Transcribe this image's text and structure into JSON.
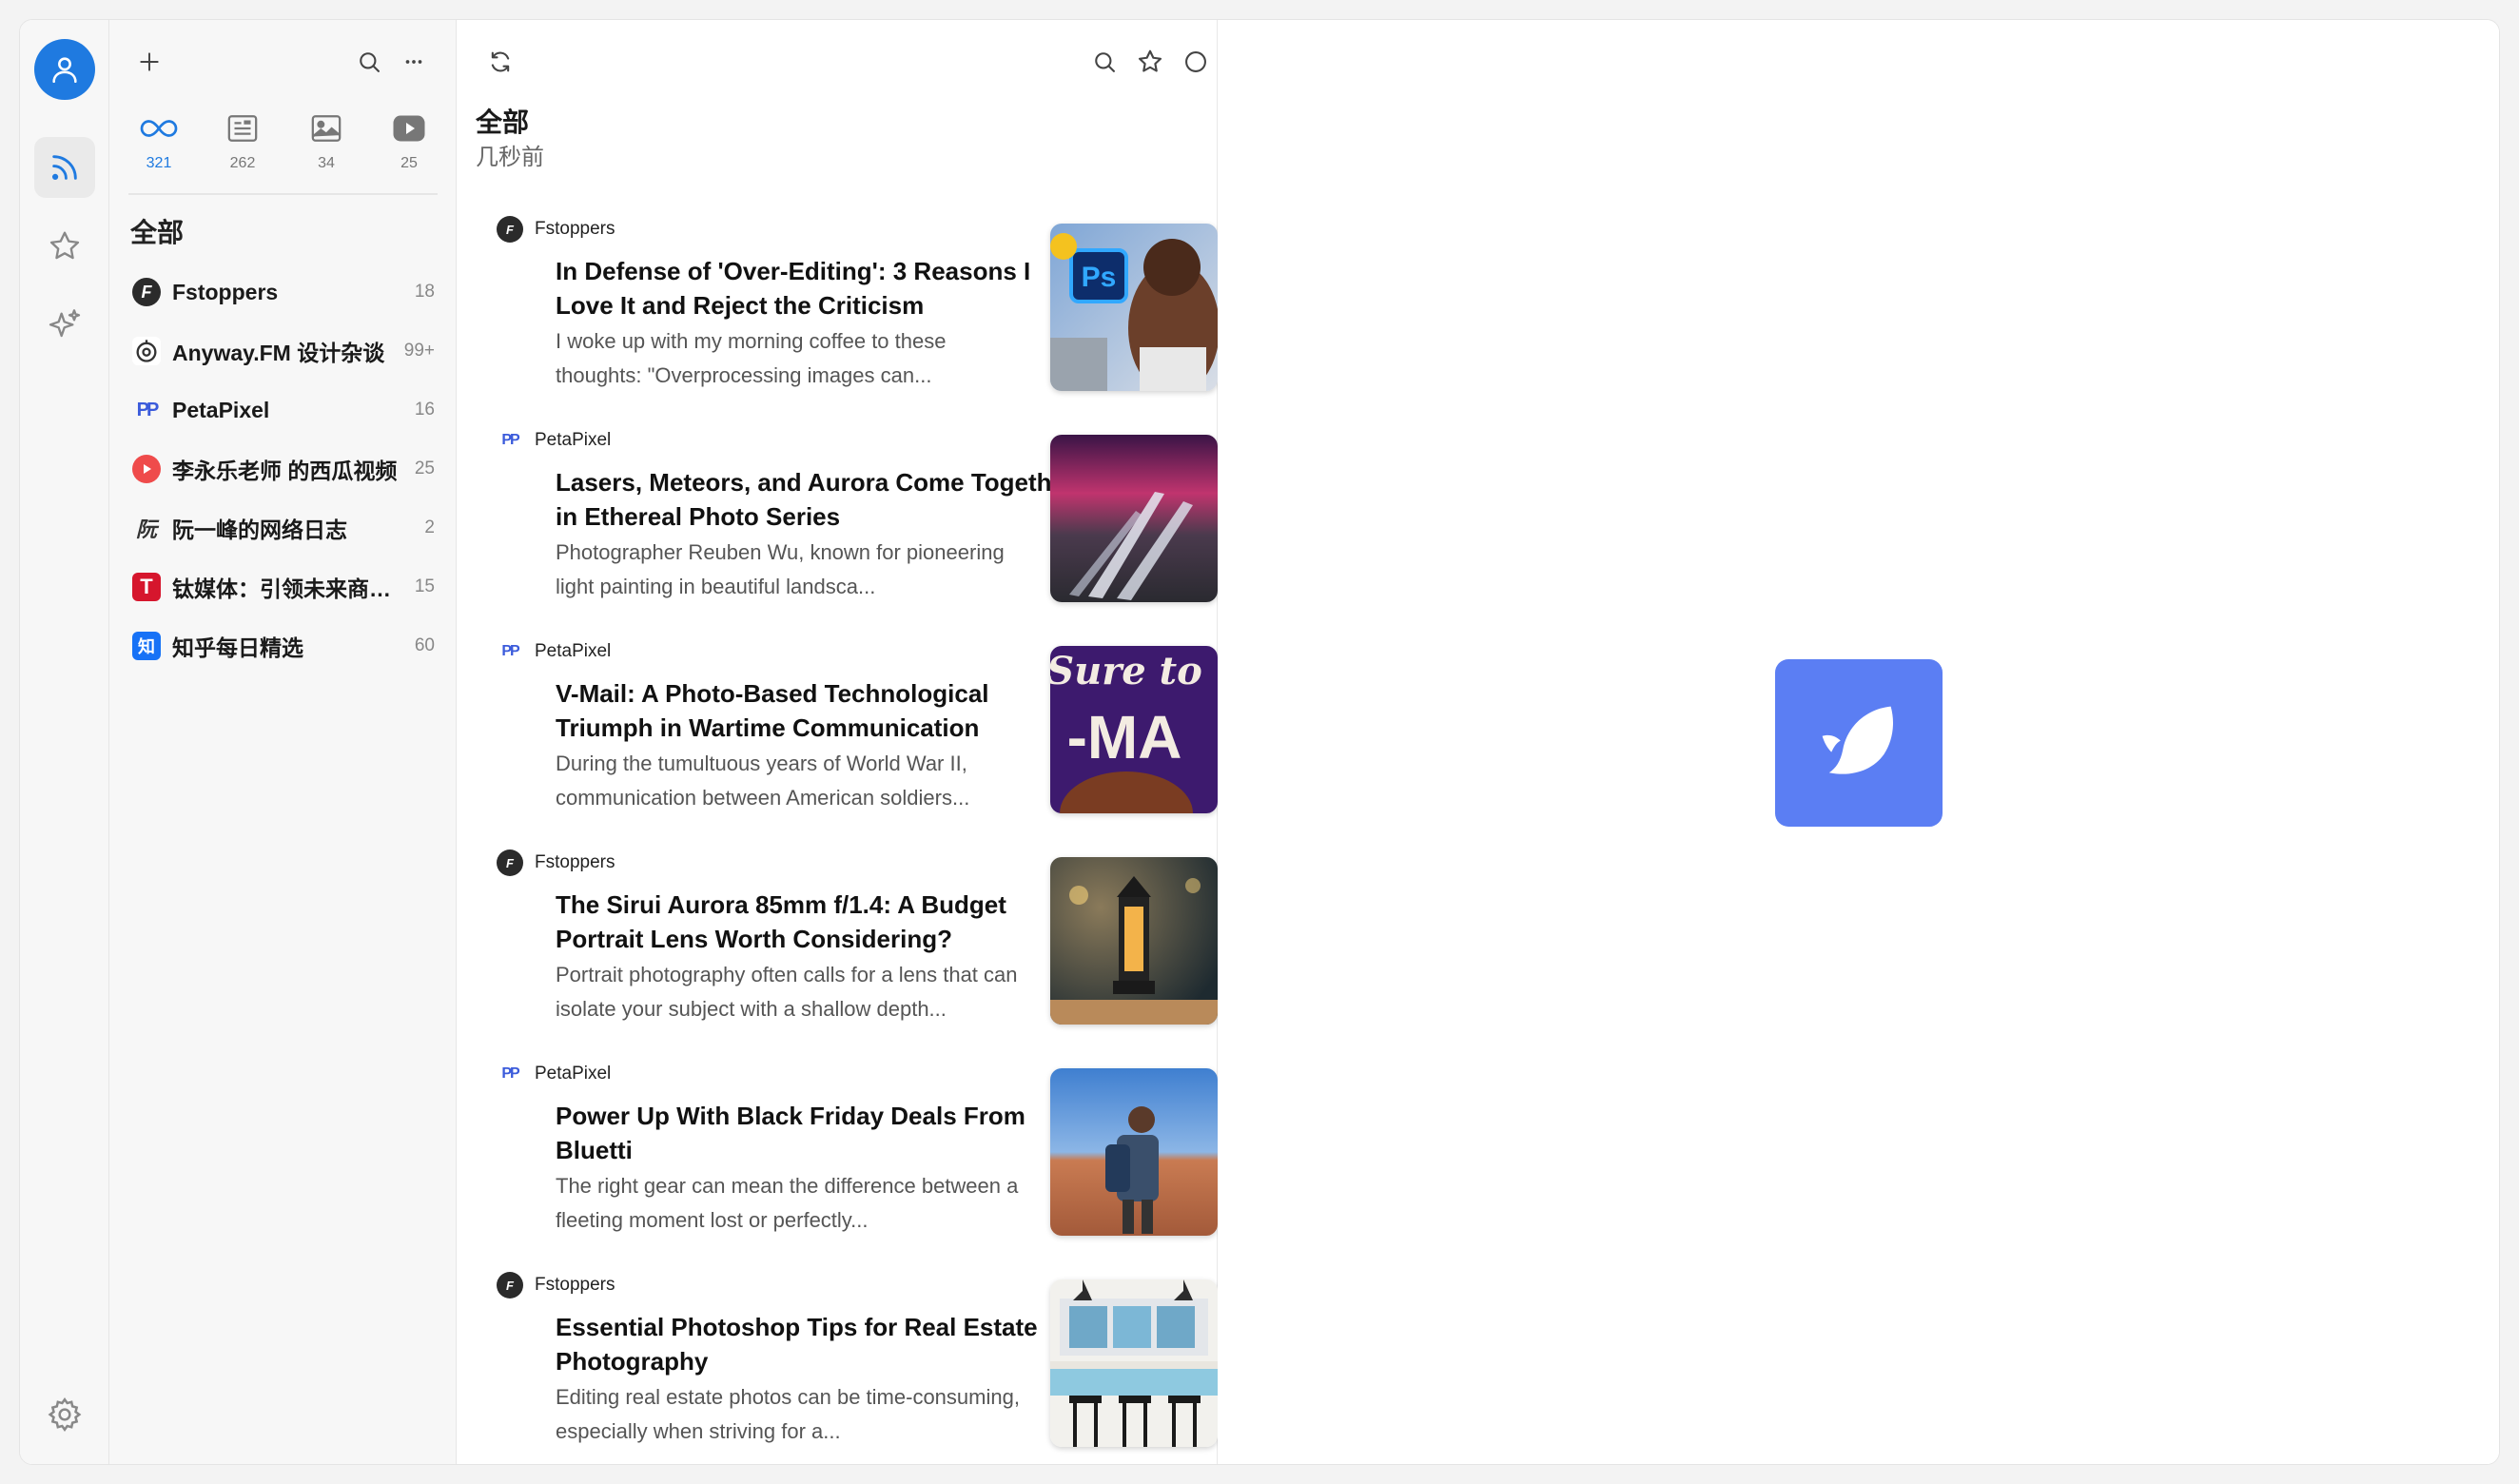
{
  "rail": {
    "avatar_icon": "user-icon",
    "items": [
      {
        "name": "rss-icon",
        "active": true
      },
      {
        "name": "star-icon",
        "active": false
      },
      {
        "name": "sparkles-icon",
        "active": false
      }
    ],
    "settings_icon": "gear-icon"
  },
  "sidebar": {
    "categories": [
      {
        "name": "all",
        "icon": "infinity-icon",
        "count": "321",
        "active": true
      },
      {
        "name": "articles",
        "icon": "article-icon",
        "count": "262",
        "active": false
      },
      {
        "name": "pictures",
        "icon": "image-icon",
        "count": "34",
        "active": false
      },
      {
        "name": "videos",
        "icon": "video-icon",
        "count": "25",
        "active": false
      }
    ],
    "section_title": "全部",
    "feeds": [
      {
        "name": "Fstoppers",
        "count": "18",
        "fav_text": "F",
        "fav_color": "#2b2b2b"
      },
      {
        "name": "Anyway.FM 设计杂谈",
        "count": "99+",
        "fav_text": "◎",
        "fav_color": "#333333"
      },
      {
        "name": "PetaPixel",
        "count": "16",
        "fav_text": "PP",
        "fav_color": "#ffffff"
      },
      {
        "name": "李永乐老师 的西瓜视频",
        "count": "25",
        "fav_text": "●",
        "fav_color": "#ef4b4b"
      },
      {
        "name": "阮一峰的网络日志",
        "count": "2",
        "fav_text": "阮",
        "fav_color": "#ffffff"
      },
      {
        "name": "钛媒体：引领未来商业与生活新知",
        "count": "15",
        "fav_text": "T",
        "fav_color": "#d6162d"
      },
      {
        "name": "知乎每日精选",
        "count": "60",
        "fav_text": "知",
        "fav_color": "#1772f6"
      }
    ]
  },
  "list": {
    "title": "全部",
    "subtitle": "几秒前",
    "entries": [
      {
        "source": "Fstoppers",
        "title": "In Defense of 'Over-Editing': 3 Reasons I Love It and Reject the Criticism",
        "desc": "I woke up with my morning coffee to these thoughts: \"Overprocessing images can...",
        "thumb": "ps"
      },
      {
        "source": "PetaPixel",
        "title": "Lasers, Meteors, and Aurora Come Together in Ethereal Photo Series",
        "desc": "Photographer Reuben Wu, known for pioneering light painting in beautiful landsca...",
        "thumb": "aurora"
      },
      {
        "source": "PetaPixel",
        "title": "V-Mail: A Photo-Based Technological Triumph in Wartime Communication",
        "desc": "During the tumultuous years of World War II, communication between American soldiers...",
        "thumb": "vmail"
      },
      {
        "source": "Fstoppers",
        "title": "The Sirui Aurora 85mm f/1.4: A Budget Portrait Lens Worth Considering?",
        "desc": "Portrait photography often calls for a lens that can isolate your subject with a shallow depth...",
        "thumb": "lantern"
      },
      {
        "source": "PetaPixel",
        "title": "Power Up With Black Friday Deals From Bluetti",
        "desc": "The right gear can mean the difference between a fleeting moment lost or perfectly...",
        "thumb": "hiker"
      },
      {
        "source": "Fstoppers",
        "title": "Essential Photoshop Tips for Real Estate Photography",
        "desc": "Editing real estate photos can be time-consuming, especially when striving for a...",
        "thumb": "kitchen"
      }
    ],
    "thumb_texts": {
      "ps": "Ps",
      "vmail_top": "Sure to",
      "vmail_bottom": "-MA"
    }
  },
  "reader": {
    "logo_icon": "bird-logo-icon",
    "logo_color": "#5b7ef3"
  }
}
